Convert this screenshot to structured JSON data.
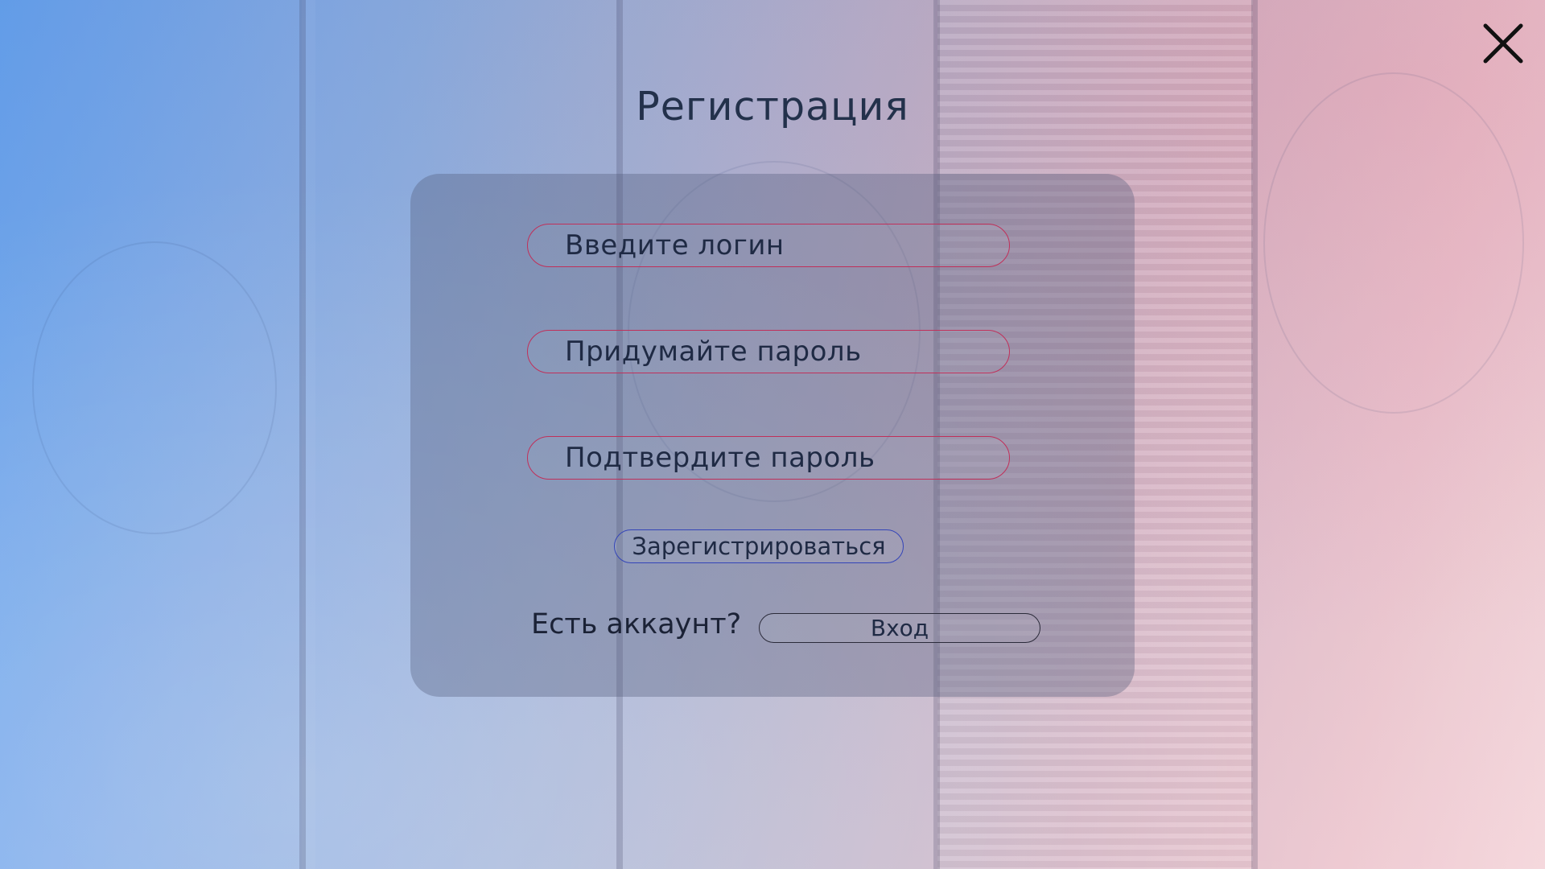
{
  "window": {
    "close_icon": "close-icon"
  },
  "title": "Регистрация",
  "form": {
    "login_placeholder": "Введите логин",
    "password_placeholder": "Придумайте пароль",
    "confirm_placeholder": "Подтвердите пароль",
    "login_value": "",
    "password_value": "",
    "confirm_value": "",
    "register_label": "Зарегистрироваться",
    "has_account_label": "Есть аккаунт?",
    "sign_in_label": "Вход"
  },
  "colors": {
    "gradient_left": "#5f9ff0",
    "gradient_right": "#f4d3d8",
    "field_border": "#c0305a",
    "register_border": "#3344b8",
    "login_border": "#2b2b3a",
    "text": "#1f2a44"
  }
}
